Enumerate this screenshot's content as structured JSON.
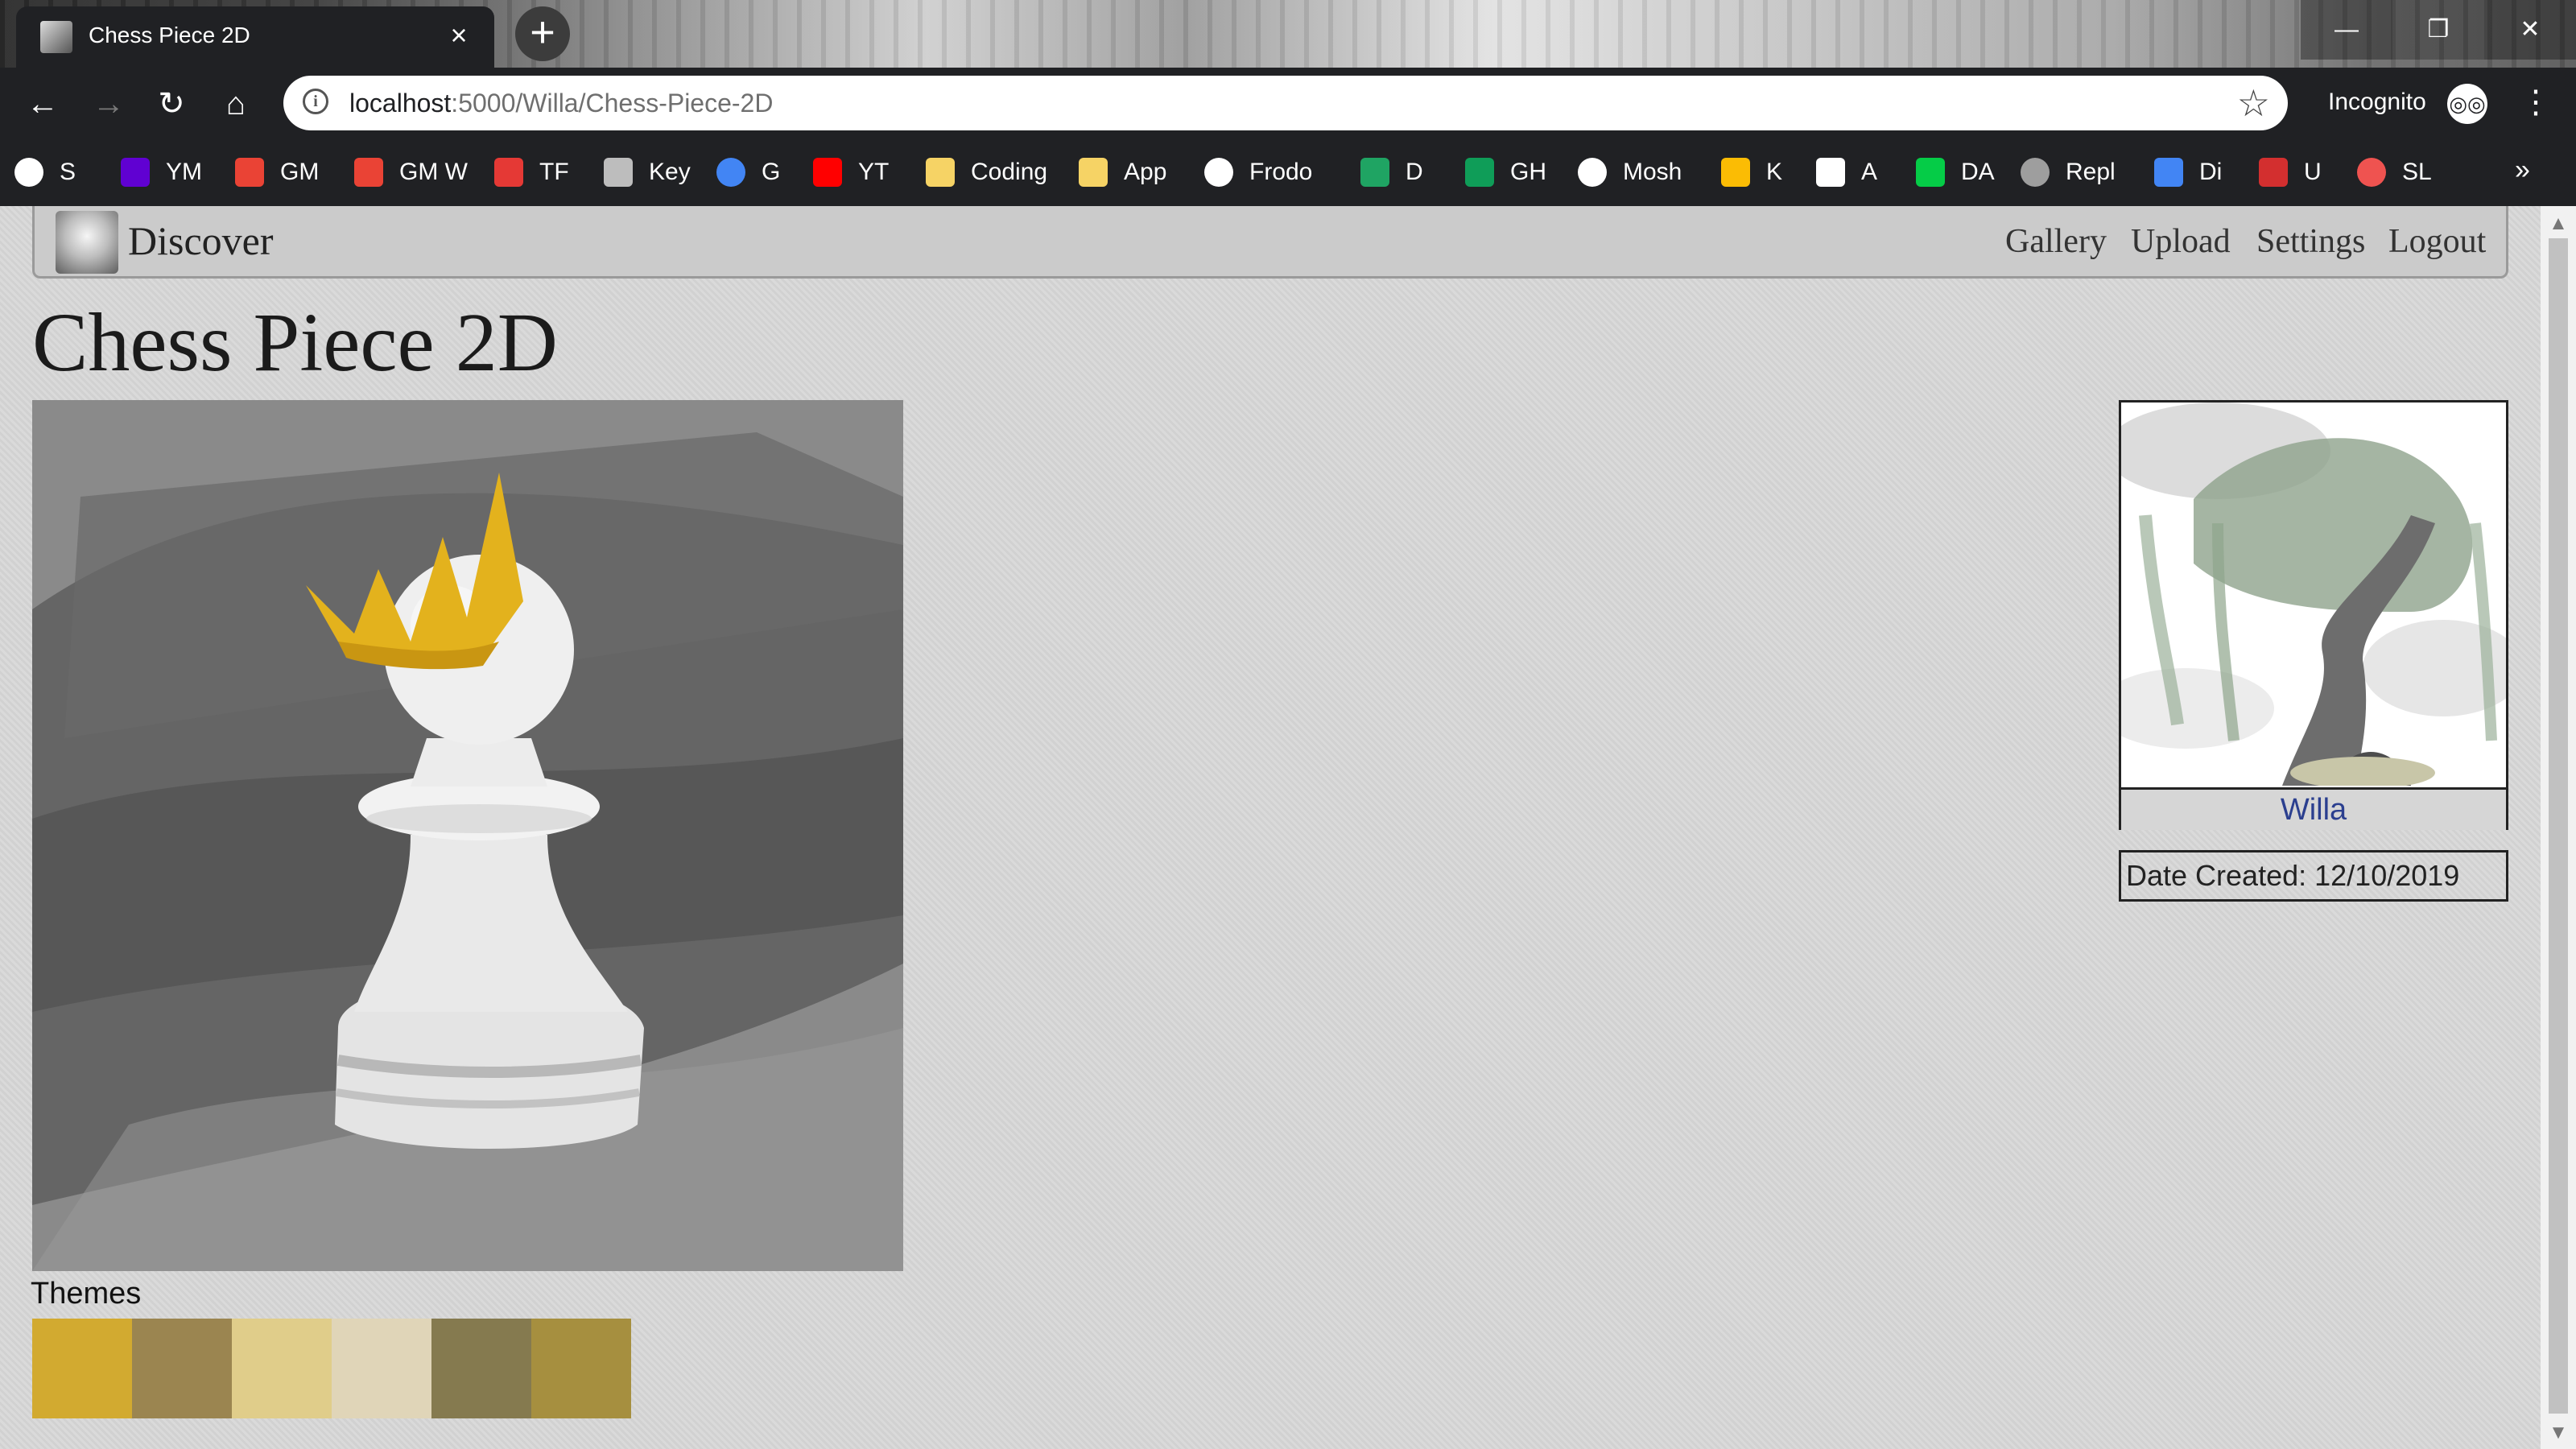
{
  "tab": {
    "title": "Chess Piece 2D",
    "close_icon": "×"
  },
  "new_tab_icon": "+",
  "window_controls": {
    "minimize": "—",
    "maximize": "❐",
    "close": "✕"
  },
  "toolbar": {
    "back_icon": "←",
    "forward_icon": "→",
    "reload_icon": "↻",
    "home_icon": "⌂",
    "url_host": "localhost",
    "url_path": ":5000/Willa/Chess-Piece-2D",
    "star_icon": "☆",
    "incognito_label": "Incognito",
    "incognito_icon": "◎◎",
    "menu_icon": "⋮"
  },
  "bookmarks": [
    {
      "label": "S",
      "color": "#ffffff",
      "icon": "globe-icon"
    },
    {
      "label": "YM",
      "color": "#6001d2",
      "icon": "yahoo-icon"
    },
    {
      "label": "GM",
      "color": "#ea4335",
      "icon": "gmail-icon"
    },
    {
      "label": "GM W",
      "color": "#ea4335",
      "icon": "gmail-icon"
    },
    {
      "label": "TF",
      "color": "#e53935",
      "icon": "tf-icon"
    },
    {
      "label": "Key",
      "color": "#bdbdbd",
      "icon": "key-icon"
    },
    {
      "label": "G",
      "color": "#4285f4",
      "icon": "google-icon"
    },
    {
      "label": "YT",
      "color": "#ff0000",
      "icon": "youtube-icon"
    },
    {
      "label": "Coding",
      "color": "#f6d365",
      "icon": "folder-icon"
    },
    {
      "label": "App",
      "color": "#f6d365",
      "icon": "folder-icon"
    },
    {
      "label": "Frodo",
      "color": "#ffffff",
      "icon": "globe-icon"
    },
    {
      "label": "D",
      "color": "#1fa463",
      "icon": "drive-icon"
    },
    {
      "label": "GH",
      "color": "#0f9d58",
      "icon": "hangouts-icon"
    },
    {
      "label": "Mosh",
      "color": "#ffffff",
      "icon": "globe-icon"
    },
    {
      "label": "K",
      "color": "#fbbc04",
      "icon": "keep-icon"
    },
    {
      "label": "A",
      "color": "#ffffff",
      "icon": "amazon-icon"
    },
    {
      "label": "DA",
      "color": "#05cc47",
      "icon": "deviantart-icon"
    },
    {
      "label": "Repl",
      "color": "#9e9e9e",
      "icon": "repl-icon"
    },
    {
      "label": "Di",
      "color": "#4285f4",
      "icon": "calendar-icon"
    },
    {
      "label": "U",
      "color": "#d32f2f",
      "icon": "udemy-icon"
    },
    {
      "label": "SL",
      "color": "#ef5350",
      "icon": "sl-icon"
    }
  ],
  "bookmarks_more": "»",
  "site": {
    "brand": "Discover",
    "nav": {
      "gallery": "Gallery",
      "upload": "Upload",
      "settings": "Settings",
      "logout": "Logout"
    }
  },
  "artwork": {
    "title": "Chess Piece 2D"
  },
  "themes": {
    "label": "Themes",
    "colors": [
      "#d2aa30",
      "#9b8550",
      "#e0cd8a",
      "#e0d5b8",
      "#857a4f",
      "#a68f3f"
    ]
  },
  "artist": {
    "name": "Willa"
  },
  "date_created": "Date Created: 12/10/2019",
  "scrollbar": {
    "up": "▲",
    "down": "▼"
  }
}
